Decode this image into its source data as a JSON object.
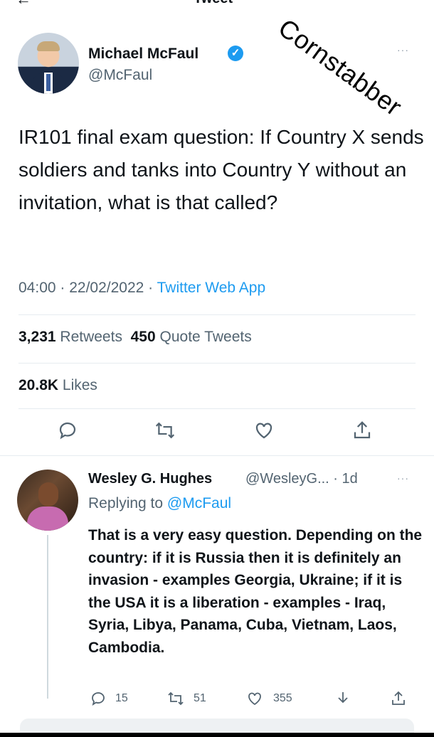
{
  "header": {
    "back_icon": "arrow-left-icon",
    "title": "Tweet"
  },
  "watermark": "Cornstabber",
  "tweet": {
    "author_name": "Michael McFaul",
    "verified_icon": "verified-badge-icon",
    "author_handle": "@McFaul",
    "more_label": "···",
    "text": "IR101 final exam question: If Country X sends soldiers and tanks into Country Y without an invitation, what is that called?",
    "time": "04:00 · 22/02/2022 · ",
    "app": "Twitter Web App",
    "retweets_count": "3,231",
    "retweets_label": "Retweets",
    "quotes_count": "450",
    "quotes_label": "Quote Tweets",
    "likes_count": "20.8K",
    "likes_label": "Likes",
    "actions": [
      "reply-icon",
      "retweet-icon",
      "like-icon",
      "share-icon"
    ]
  },
  "reply": {
    "author_name": "Wesley G. Hughes",
    "author_meta": "@WesleyG... · 1d",
    "more_label": "···",
    "replying_prefix": "Replying to ",
    "replying_to": "@McFaul",
    "text": "That is a very easy question. Depending on the country: if it is Russia then it is definitely an invasion - examples Georgia, Ukraine; if it is the USA it is a liberation - examples - Iraq, Syria, Libya, Panama, Cuba, Vietnam, Laos, Cambodia.",
    "reply_count": "15",
    "retweet_count": "51",
    "like_count": "355"
  },
  "colors": {
    "accent": "#1d9bf0",
    "secondary_text": "#536471",
    "primary_text": "#0f1419"
  }
}
